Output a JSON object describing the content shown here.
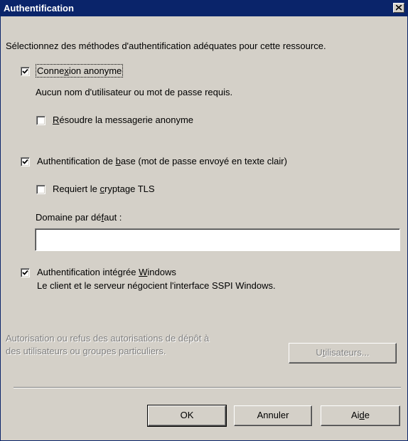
{
  "dialog": {
    "title": "Authentification",
    "close_glyph": "×"
  },
  "intro": "Sélectionnez des méthodes d'authentification adéquates pour cette ressource.",
  "anonymous": {
    "checked": true,
    "label_pre": "Conne",
    "label_accel": "x",
    "label_post": "ion anonyme",
    "description": "Aucun nom d'utilisateur ou mot de passe requis.",
    "resolve": {
      "checked": false,
      "label_accel": "R",
      "label_post": "ésoudre la messagerie anonyme"
    }
  },
  "basic": {
    "checked": true,
    "label_pre": "Authentification de ",
    "label_accel": "b",
    "label_post": "ase (mot de passe envoyé en texte clair)",
    "tls": {
      "checked": false,
      "label_pre": "Requiert le ",
      "label_accel": "c",
      "label_post": "ryptage TLS"
    },
    "domain": {
      "label_pre": "Domaine par dé",
      "label_accel": "f",
      "label_post": "aut :",
      "value": ""
    }
  },
  "integrated": {
    "checked": true,
    "label_pre": "Authentification intégrée ",
    "label_accel": "W",
    "label_post": "indows",
    "description": "Le client et le serveur négocient l'interface SSPI Windows."
  },
  "relay": {
    "line1": "Autorisation ou refus des autorisations de dépôt à",
    "line2": "des utilisateurs ou groupes particuliers.",
    "button_pre": "U",
    "button_accel": "t",
    "button_post": "ilisateurs..."
  },
  "buttons": {
    "ok": "OK",
    "cancel": "Annuler",
    "help_pre": "Ai",
    "help_accel": "d",
    "help_post": "e"
  },
  "colors": {
    "titlebar": "#0a246a",
    "face": "#d4d0c8",
    "disabled_text": "#808080"
  }
}
